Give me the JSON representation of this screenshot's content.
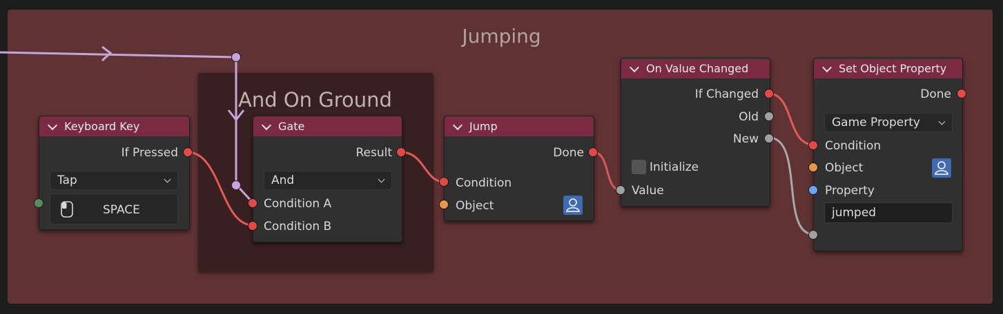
{
  "frame": {
    "title": "Jumping"
  },
  "subframe": {
    "title": "And On Ground"
  },
  "nodes": {
    "keyboard_key": {
      "title": "Keyboard Key",
      "output": "If Pressed",
      "mode": "Tap",
      "key": "SPACE",
      "mouse_icon": "mouse-icon"
    },
    "gate": {
      "title": "Gate",
      "output": "Result",
      "operation": "And",
      "inputs": [
        "Condition A",
        "Condition B"
      ]
    },
    "jump": {
      "title": "Jump",
      "output": "Done",
      "inputs": [
        "Condition",
        "Object"
      ],
      "object_icon": "user-icon"
    },
    "on_value_changed": {
      "title": "On Value Changed",
      "outputs": [
        "If Changed",
        "Old",
        "New"
      ],
      "initialize_label": "Initialize",
      "initialize_checked": false,
      "input": "Value"
    },
    "set_object_property": {
      "title": "Set Object Property",
      "output": "Done",
      "mode": "Game Property",
      "inputs": [
        "Condition",
        "Object",
        "Property"
      ],
      "property_value": "jumped",
      "object_icon": "user-icon"
    }
  },
  "colors": {
    "frame_bg": "#5f3234",
    "subframe_bg": "#3a1f20",
    "node_header": "#7b2a44",
    "node_body": "#303030",
    "socket_condition": "#e24a4a",
    "socket_object": "#e8964c",
    "socket_value": "#a0a0a0",
    "socket_property": "#6fa2ef",
    "reroute_wire": "#c6a6d8"
  }
}
